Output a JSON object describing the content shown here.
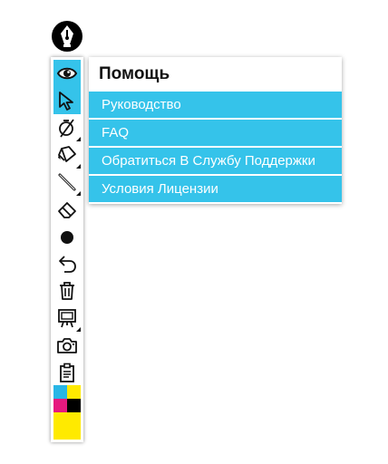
{
  "app": {
    "logo_icon": "pen-nib-icon"
  },
  "toolbar": {
    "accent_color": "#35c3ea",
    "tools": [
      {
        "name": "view-tool",
        "icon": "eye-icon",
        "active": true
      },
      {
        "name": "select-tool",
        "icon": "cursor-arrow-icon",
        "active": true
      },
      {
        "name": "shape-tool",
        "icon": "circle-compass-icon",
        "active": false
      },
      {
        "name": "highlighter-tool",
        "icon": "marker-icon",
        "active": false
      },
      {
        "name": "pen-tool",
        "icon": "pen-line-icon",
        "active": false
      },
      {
        "name": "eraser-tool",
        "icon": "eraser-icon",
        "active": false
      },
      {
        "name": "dot-tool",
        "icon": "filled-circle-icon",
        "active": false
      },
      {
        "name": "undo-tool",
        "icon": "undo-icon",
        "active": false
      },
      {
        "name": "delete-tool",
        "icon": "trash-icon",
        "active": false
      },
      {
        "name": "board-tool",
        "icon": "easel-icon",
        "active": false
      },
      {
        "name": "screenshot-tool",
        "icon": "camera-icon",
        "active": false
      },
      {
        "name": "clipboard-tool",
        "icon": "clipboard-icon",
        "active": false
      }
    ],
    "palette": {
      "cyan": "#29b6e6",
      "yellow": "#ffea00",
      "magenta": "#e6197f",
      "black": "#000000",
      "current": "#ffea00"
    }
  },
  "help_menu": {
    "title": "Помощь",
    "items": [
      {
        "label": "Руководство"
      },
      {
        "label": "FAQ"
      },
      {
        "label": "Обратиться В Службу Поддержки"
      },
      {
        "label": "Условия Лицензии"
      }
    ]
  }
}
